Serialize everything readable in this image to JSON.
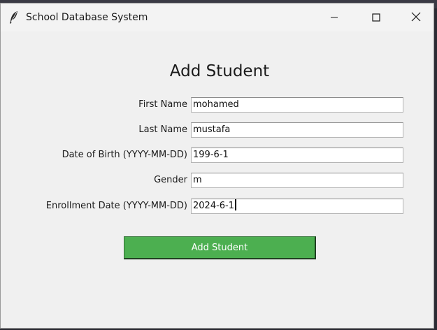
{
  "window": {
    "title": "School Database System"
  },
  "form": {
    "heading": "Add Student",
    "fields": [
      {
        "label": "First Name",
        "value": "mohamed"
      },
      {
        "label": "Last Name",
        "value": "mustafa"
      },
      {
        "label": "Date of Birth (YYYY-MM-DD)",
        "value": "199-6-1"
      },
      {
        "label": "Gender",
        "value": "m"
      },
      {
        "label": "Enrollment Date (YYYY-MM-DD)",
        "value": "2024-6-1"
      }
    ],
    "submit_label": "Add Student"
  },
  "icons": {
    "app": "feather-icon",
    "minimize": "minimize-icon",
    "maximize": "maximize-icon",
    "close": "close-icon"
  },
  "colors": {
    "submit_bg": "#4caf50",
    "submit_text": "#ffffff",
    "window_bg": "#f0f0f0"
  }
}
